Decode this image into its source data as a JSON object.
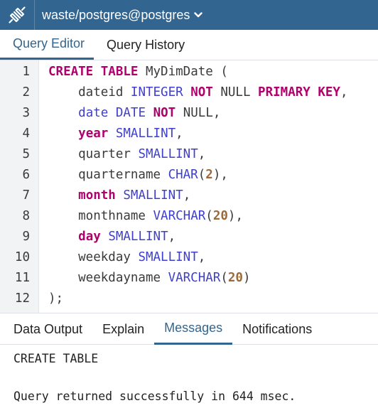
{
  "header": {
    "connection": "waste/postgres@postgres",
    "server_icon": "server-plug-icon",
    "dropdown_icon": "chevron-down-icon",
    "bg_color": "#326690"
  },
  "editor_tabs": [
    {
      "label": "Query Editor",
      "active": true
    },
    {
      "label": "Query History",
      "active": false
    }
  ],
  "editor": {
    "lines": [
      {
        "num": "1",
        "tokens": [
          {
            "t": "CREATE TABLE",
            "c": "kw"
          },
          {
            "t": " MyDimDate (",
            "c": "id"
          }
        ]
      },
      {
        "num": "2",
        "tokens": [
          {
            "t": "    dateid ",
            "c": "id"
          },
          {
            "t": "INTEGER",
            "c": "ty"
          },
          {
            "t": " ",
            "c": "id"
          },
          {
            "t": "NOT",
            "c": "kw"
          },
          {
            "t": " NULL ",
            "c": "id"
          },
          {
            "t": "PRIMARY KEY",
            "c": "kw"
          },
          {
            "t": ",",
            "c": "id"
          }
        ]
      },
      {
        "num": "3",
        "tokens": [
          {
            "t": "    ",
            "c": "id"
          },
          {
            "t": "date",
            "c": "ty"
          },
          {
            "t": " ",
            "c": "id"
          },
          {
            "t": "DATE",
            "c": "ty"
          },
          {
            "t": " ",
            "c": "id"
          },
          {
            "t": "NOT",
            "c": "kw"
          },
          {
            "t": " NULL,",
            "c": "id"
          }
        ]
      },
      {
        "num": "4",
        "tokens": [
          {
            "t": "    ",
            "c": "id"
          },
          {
            "t": "year",
            "c": "kw"
          },
          {
            "t": " ",
            "c": "id"
          },
          {
            "t": "SMALLINT",
            "c": "ty"
          },
          {
            "t": ",",
            "c": "id"
          }
        ]
      },
      {
        "num": "5",
        "tokens": [
          {
            "t": "    quarter ",
            "c": "id"
          },
          {
            "t": "SMALLINT",
            "c": "ty"
          },
          {
            "t": ",",
            "c": "id"
          }
        ]
      },
      {
        "num": "6",
        "tokens": [
          {
            "t": "    quartername ",
            "c": "id"
          },
          {
            "t": "CHAR",
            "c": "ty"
          },
          {
            "t": "(",
            "c": "id"
          },
          {
            "t": "2",
            "c": "nu"
          },
          {
            "t": "),",
            "c": "id"
          }
        ]
      },
      {
        "num": "7",
        "tokens": [
          {
            "t": "    ",
            "c": "id"
          },
          {
            "t": "month",
            "c": "kw"
          },
          {
            "t": " ",
            "c": "id"
          },
          {
            "t": "SMALLINT",
            "c": "ty"
          },
          {
            "t": ",",
            "c": "id"
          }
        ]
      },
      {
        "num": "8",
        "tokens": [
          {
            "t": "    monthname ",
            "c": "id"
          },
          {
            "t": "VARCHAR",
            "c": "ty"
          },
          {
            "t": "(",
            "c": "id"
          },
          {
            "t": "20",
            "c": "nu"
          },
          {
            "t": "),",
            "c": "id"
          }
        ]
      },
      {
        "num": "9",
        "tokens": [
          {
            "t": "    ",
            "c": "id"
          },
          {
            "t": "day",
            "c": "kw"
          },
          {
            "t": " ",
            "c": "id"
          },
          {
            "t": "SMALLINT",
            "c": "ty"
          },
          {
            "t": ",",
            "c": "id"
          }
        ]
      },
      {
        "num": "10",
        "tokens": [
          {
            "t": "    weekday ",
            "c": "id"
          },
          {
            "t": "SMALLINT",
            "c": "ty"
          },
          {
            "t": ",",
            "c": "id"
          }
        ]
      },
      {
        "num": "11",
        "tokens": [
          {
            "t": "    weekdayname ",
            "c": "id"
          },
          {
            "t": "VARCHAR",
            "c": "ty"
          },
          {
            "t": "(",
            "c": "id"
          },
          {
            "t": "20",
            "c": "nu"
          },
          {
            "t": ")",
            "c": "id"
          }
        ]
      },
      {
        "num": "12",
        "tokens": [
          {
            "t": ");",
            "c": "id"
          }
        ]
      }
    ],
    "colors": {
      "keyword": "#b0006d",
      "type": "#3f3fc9",
      "number": "#9c6a3a",
      "text": "#3a3a3a"
    }
  },
  "output_tabs": [
    {
      "label": "Data Output",
      "active": false
    },
    {
      "label": "Explain",
      "active": false
    },
    {
      "label": "Messages",
      "active": true
    },
    {
      "label": "Notifications",
      "active": false
    }
  ],
  "messages": {
    "line1": "CREATE TABLE",
    "line2": "Query returned successfully in 644 msec."
  }
}
